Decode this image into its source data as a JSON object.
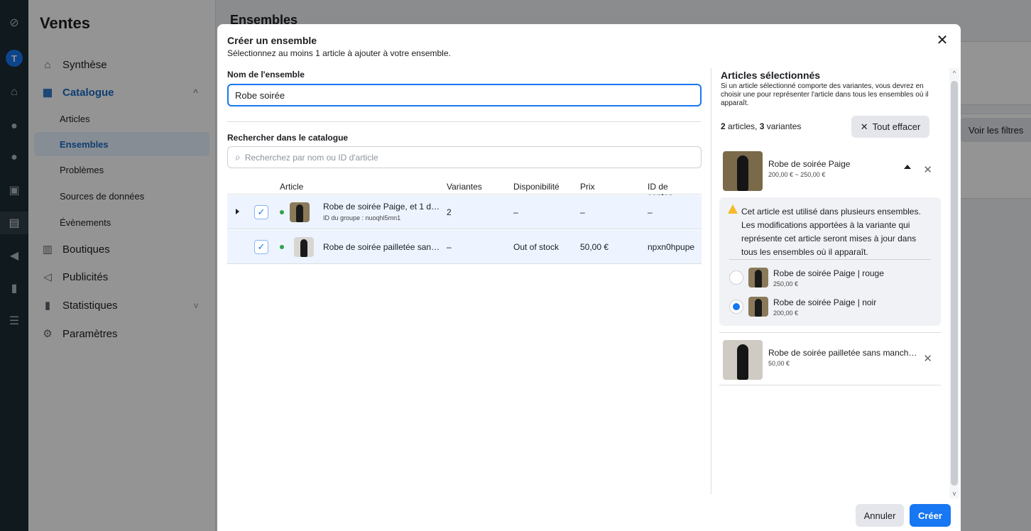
{
  "rail": {
    "avatar_letter": "T"
  },
  "sidebar": {
    "title": "Ventes",
    "items": [
      {
        "label": "Synthèse"
      },
      {
        "label": "Catalogue"
      },
      {
        "label": "Articles"
      },
      {
        "label": "Ensembles"
      },
      {
        "label": "Problèmes"
      },
      {
        "label": "Sources de données"
      },
      {
        "label": "Évènements"
      },
      {
        "label": "Boutiques"
      },
      {
        "label": "Publicités"
      },
      {
        "label": "Statistiques"
      },
      {
        "label": "Paramètres"
      }
    ]
  },
  "background": {
    "page_title": "Ensembles",
    "filter_label": "Voir les filtres"
  },
  "modal": {
    "title": "Créer un ensemble",
    "subtitle": "Sélectionnez au moins 1 article à ajouter à votre ensemble.",
    "name_label": "Nom de l'ensemble",
    "name_value": "Robe soirée",
    "search_label": "Rechercher dans le catalogue",
    "search_placeholder": "Recherchez par nom ou ID d'article",
    "columns": [
      "Article",
      "Variantes",
      "Disponibilité",
      "Prix",
      "ID de conten…"
    ],
    "rows": [
      {
        "name": "Robe de soirée Paige, et 1 d…",
        "group_id": "ID du groupe : nuoqhl5mn1",
        "variants": "2",
        "availability": "–",
        "price": "–",
        "content_id": "–"
      },
      {
        "name": "Robe de soirée pailletée san…",
        "variants": "–",
        "availability": "Out of stock",
        "price": "50,00 €",
        "content_id": "npxn0hpupe"
      }
    ],
    "selected": {
      "title": "Articles sélectionnés",
      "description": "Si un article sélectionné comporte des variantes, vous devrez en choisir une pour représenter l'article dans tous les ensembles où il apparaît.",
      "count_articles": "2",
      "count_articles_label": " articles, ",
      "count_variants": "3",
      "count_variants_label": " variantes",
      "clear_label": "Tout effacer",
      "items": [
        {
          "name": "Robe de soirée Paige",
          "price": "200,00 € ~ 250,00 €"
        },
        {
          "name": "Robe de soirée pailletée sans manch…",
          "price": "50,00 €"
        }
      ],
      "warning": "Cet article est utilisé dans plusieurs ensembles. Les modifications apportées à la variante qui représente cet article seront mises à jour dans tous les ensembles où il apparaît.",
      "variants": [
        {
          "name": "Robe de soirée Paige | rouge",
          "price": "250,00 €",
          "selected": false
        },
        {
          "name": "Robe de soirée Paige | noir",
          "price": "200,00 €",
          "selected": true
        }
      ]
    },
    "cancel_label": "Annuler",
    "create_label": "Créer"
  },
  "colors": {
    "accent": "#1877f2",
    "available": "#31a24c",
    "warning": "#f7b928"
  }
}
